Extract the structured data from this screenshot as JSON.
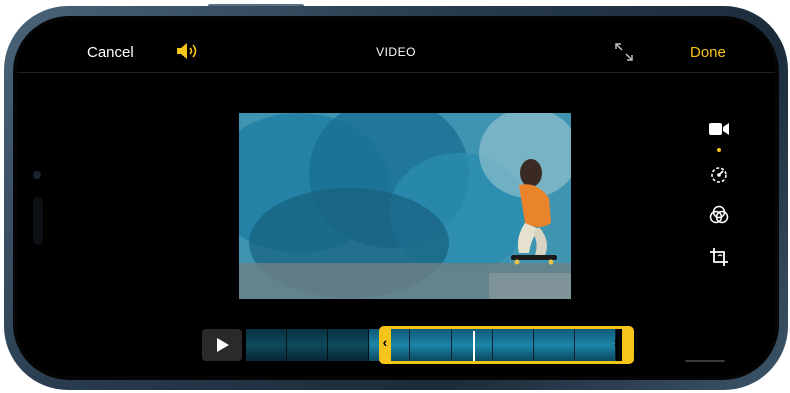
{
  "header": {
    "cancel_label": "Cancel",
    "title": "VIDEO",
    "done_label": "Done"
  },
  "icons": {
    "volume": "speaker-icon",
    "expand": "expand-icon",
    "video": "video-camera-icon",
    "adjust": "adjust-dial-icon",
    "filters": "filters-icon",
    "crop": "crop-rotate-icon",
    "play": "play-icon"
  },
  "colors": {
    "accent": "#f6c51b",
    "background": "#000000",
    "text": "#ffffff"
  }
}
